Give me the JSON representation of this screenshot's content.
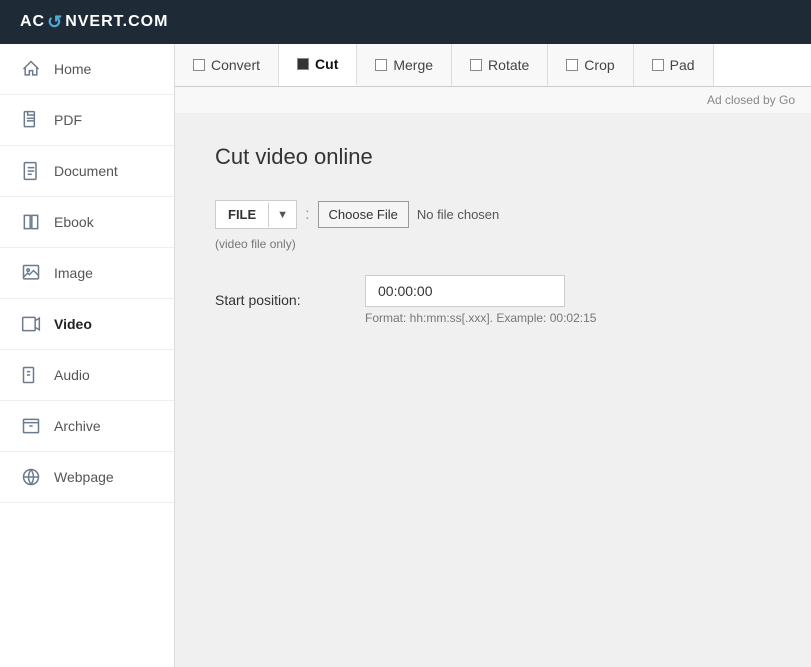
{
  "header": {
    "logo": "AC",
    "logo_arrow": "↺",
    "logo_rest": "NVERT.COM"
  },
  "sidebar": {
    "items": [
      {
        "id": "home",
        "label": "Home",
        "icon": "🏠",
        "active": false
      },
      {
        "id": "pdf",
        "label": "PDF",
        "icon": "📄",
        "active": false
      },
      {
        "id": "document",
        "label": "Document",
        "icon": "📝",
        "active": false
      },
      {
        "id": "ebook",
        "label": "Ebook",
        "icon": "📖",
        "active": false
      },
      {
        "id": "image",
        "label": "Image",
        "icon": "🖼",
        "active": false
      },
      {
        "id": "video",
        "label": "Video",
        "icon": "🎥",
        "active": true
      },
      {
        "id": "audio",
        "label": "Audio",
        "icon": "🎵",
        "active": false
      },
      {
        "id": "archive",
        "label": "Archive",
        "icon": "🗜",
        "active": false
      },
      {
        "id": "webpage",
        "label": "Webpage",
        "icon": "🌐",
        "active": false
      }
    ]
  },
  "tabs": [
    {
      "id": "convert",
      "label": "Convert",
      "active": false
    },
    {
      "id": "cut",
      "label": "Cut",
      "active": true
    },
    {
      "id": "merge",
      "label": "Merge",
      "active": false
    },
    {
      "id": "rotate",
      "label": "Rotate",
      "active": false
    },
    {
      "id": "crop",
      "label": "Crop",
      "active": false
    },
    {
      "id": "pad",
      "label": "Pad",
      "active": false
    }
  ],
  "ad_bar": {
    "text": "Ad closed by Go"
  },
  "page": {
    "title": "Cut video online",
    "file_section": {
      "dropdown_label": "FILE",
      "dropdown_arrow": "▼",
      "separator": ":",
      "choose_file_label": "Choose File",
      "no_file_text": "No file chosen",
      "file_hint": "(video file only)"
    },
    "start_position": {
      "label": "Start position:",
      "value": "00:00:00",
      "format_hint": "Format: hh:mm:ss[.xxx]. Example:",
      "example": "00:02:15"
    }
  }
}
